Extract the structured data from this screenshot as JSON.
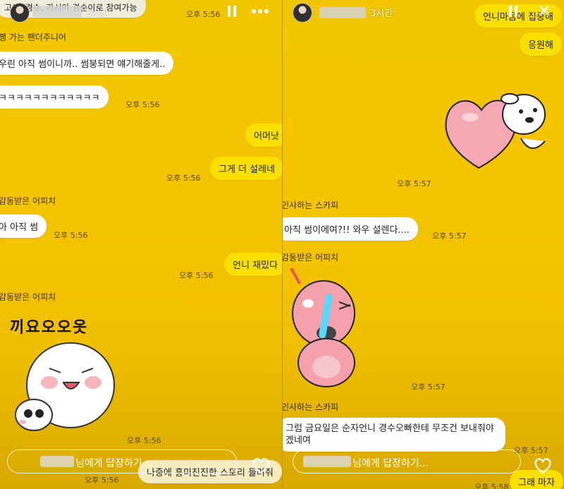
{
  "left": {
    "header_banner": "고드, 경수, 가시아 경순이로 참여가능",
    "hours": "3시간",
    "header_time": "오후 5:56",
    "messages": {
      "sender1": "쨍 가는 팬더주니어",
      "m1": "우린 아직 썸이니까.. 썸붕되면 얘기해줄게..",
      "m2": "ㅋㅋㅋㅋㅋㅋㅋㅋㅋㅋㅋㅋ",
      "t2": "오후 5:56",
      "m3": "어머낫",
      "m4": "그게 더 설레네",
      "t4": "오후 5:56",
      "sender2": "감동받은 어피치",
      "m5": "아 아직 썸",
      "t5": "오후 5:56",
      "m6": "언니 재밌다",
      "t6": "오후 5:56",
      "sender3": "감동받은 어피치",
      "sticker_caption": "끼요오오옷",
      "t7": "오후 5:56",
      "m8": "나중에 흥미진진한 스토리 들려줘",
      "t8": "오후 5:56"
    },
    "reply_text": "님에게 답장하기..."
  },
  "right": {
    "hours": "3시간",
    "m_top": "언니마음에 집중해",
    "m_top2": "응원해",
    "t_sticker": "오후 5:57",
    "sender1": "인사하는 스카피",
    "m1": "아직 썸이에여?!! 와우 설렌다....",
    "t1": "오후 5:57",
    "sender2": "감동받은 어피치",
    "t2": "오후 5:57",
    "sender3": "인사하는 스카피",
    "m3": "그럼 금요일은 순자언니 경수오빠한테 무조건 보내줘야겠네여",
    "t3": "오후 5:57",
    "m4": "그래 마자",
    "t4": "오후 5:58",
    "reply_text": "님에게 답장하기..."
  },
  "icons": [
    "pause-icon",
    "more-icon",
    "close-icon",
    "heart-icon"
  ]
}
